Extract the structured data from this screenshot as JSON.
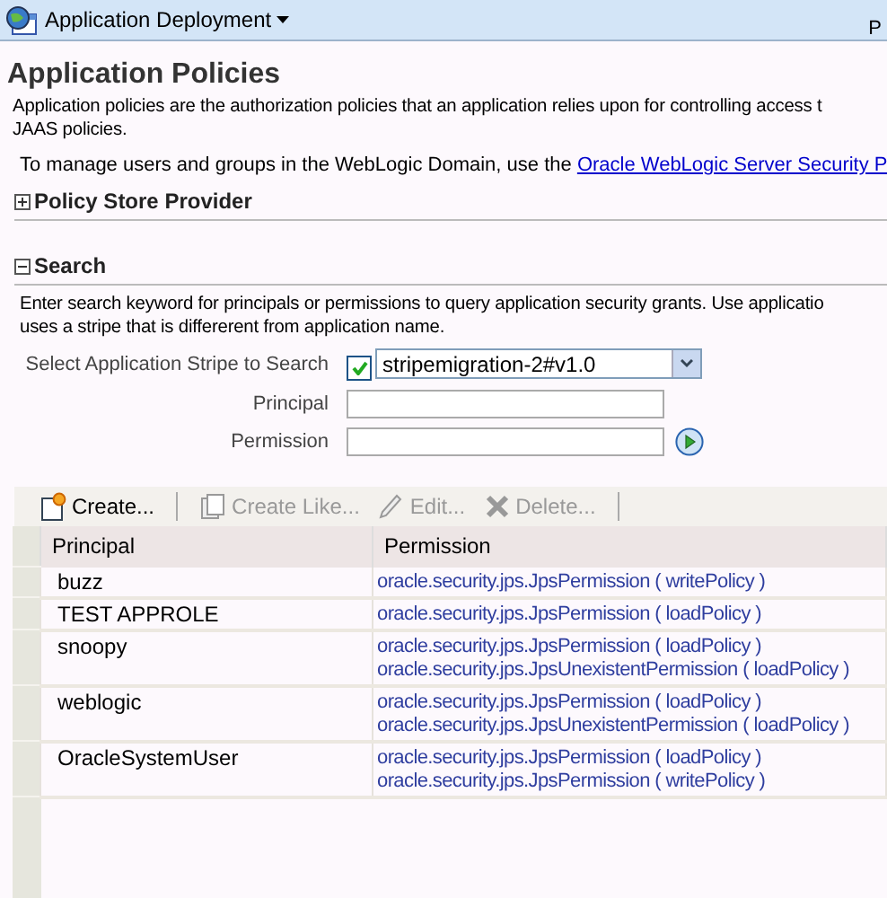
{
  "header": {
    "menu": "Application Deployment",
    "right_text": "P"
  },
  "title": "Application Policies",
  "description": "Application policies are the authorization policies that an application relies upon for controlling access t\nJAAS policies.",
  "manage_note": {
    "text": "To manage users and groups in the WebLogic Domain, use the ",
    "link": "Oracle WebLogic Server Security P"
  },
  "sections": [
    {
      "label": "Policy Store Provider",
      "expanded": false
    },
    {
      "label": "Search",
      "expanded": true
    }
  ],
  "search": {
    "instructions": "Enter search keyword for principals or permissions to query application security grants. Use applicatio\nuses a stripe that is differerent from application name.",
    "stripe_label": "Select Application Stripe to Search",
    "stripe_checked": true,
    "stripe_value": "stripemigration-2#v1.0",
    "principal_label": "Principal",
    "permission_label": "Permission"
  },
  "toolbar": [
    {
      "label": "Create...",
      "kind": "create",
      "disabled": false
    },
    {
      "label": "Create Like...",
      "kind": "create-like",
      "disabled": true
    },
    {
      "label": "Edit...",
      "kind": "edit",
      "disabled": true
    },
    {
      "label": "Delete...",
      "kind": "delete",
      "disabled": true
    }
  ],
  "table": {
    "columns": [
      "Principal",
      "Permission"
    ],
    "rows": [
      {
        "principal": "buzz",
        "permissions": [
          "oracle.security.jps.JpsPermission ( writePolicy )"
        ]
      },
      {
        "principal": "TEST APPROLE",
        "permissions": [
          "oracle.security.jps.JpsPermission ( loadPolicy )"
        ]
      },
      {
        "principal": "snoopy",
        "permissions": [
          "oracle.security.jps.JpsPermission ( loadPolicy )",
          "oracle.security.jps.JpsUnexistentPermission ( loadPolicy )"
        ]
      },
      {
        "principal": "weblogic",
        "permissions": [
          "oracle.security.jps.JpsPermission ( loadPolicy )",
          "oracle.security.jps.JpsUnexistentPermission ( loadPolicy )"
        ]
      },
      {
        "principal": "OracleSystemUser",
        "permissions": [
          "oracle.security.jps.JpsPermission ( loadPolicy )",
          "oracle.security.jps.JpsPermission ( writePolicy )"
        ]
      }
    ]
  }
}
